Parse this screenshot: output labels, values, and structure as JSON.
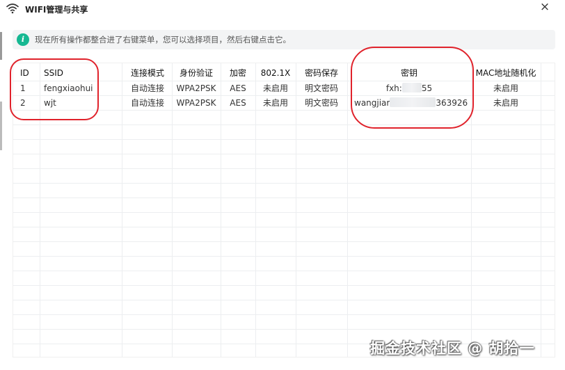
{
  "window": {
    "title": "WIFI管理与共享",
    "close_glyph": "×"
  },
  "info": {
    "text": "现在所有操作都整合进了右键菜单，您可以选择项目，然后右键点击它。",
    "icon_glyph": "i",
    "accent": "#16b892"
  },
  "table": {
    "columns": [
      "ID",
      "SSID",
      "连接模式",
      "身份验证",
      "加密",
      "802.1X",
      "密码保存",
      "密钥",
      "MAC地址随机化"
    ],
    "rows": [
      {
        "id": "1",
        "ssid": "fengxiaohui",
        "mode": "自动连接",
        "auth": "WPA2PSK",
        "enc": "AES",
        "dot1x": "未启用",
        "save": "明文密码",
        "key_prefix": "fxh:",
        "key_suffix": "55",
        "mac": "未启用"
      },
      {
        "id": "2",
        "ssid": "wjt",
        "mode": "自动连接",
        "auth": "WPA2PSK",
        "enc": "AES",
        "dot1x": "未启用",
        "save": "明文密码",
        "key_prefix": "wangjiar",
        "key_suffix": "363926",
        "mac": "未启用"
      }
    ]
  },
  "annotation_color": "#e0222b",
  "watermark": "掘金技术社区 @ 胡拾一"
}
